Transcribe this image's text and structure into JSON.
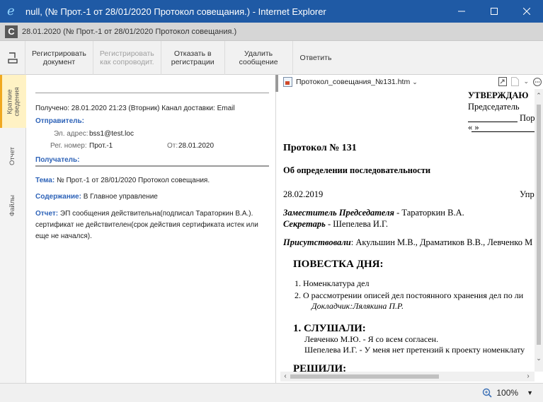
{
  "window": {
    "title": "null, (№ Прот.-1 от 28/01/2020 Протокол совещания.) - Internet Explorer",
    "ie_icon": "e"
  },
  "app": {
    "logo": "C",
    "doc_title": "28.01.2020  (№ Прот.-1 от 28/01/2020 Протокол совещания.)"
  },
  "toolbar": {
    "register_doc": "Регистрировать\nдокумент",
    "register_accomp": "Регистрировать\nкак сопроводит.",
    "refuse": "Отказать в\nрегистрации",
    "delete": "Удалить\nсообщение",
    "reply": "Ответить"
  },
  "tabs": {
    "summary": "Краткие\nсведения",
    "report": "Отчет",
    "files": "Файлы"
  },
  "info": {
    "received": "Получено: 28.01.2020 21:23 (Вторник)  Канал доставки: Email",
    "sender_label": "Отправитель:",
    "email_label": "Эл. адрес:",
    "email_value": "bss1@test.loc",
    "reg_label": "Рег. номер:",
    "reg_value": "Прот.-1",
    "from_label": "От:",
    "from_value": "28.01.2020",
    "recipient_label": "Получатель:",
    "subject_label": "Тема:",
    "subject_value": "№ Прот.-1 от 28/01/2020 Протокол совещания.",
    "content_label": "Содержание:",
    "content_value": "В Главное управление",
    "report_label": "Отчет:",
    "report_value": "ЭП сообщения действительна(подписал Тараторкин В.А.). сертификат не действителен(срок действия сертификата истек или еще не начался)."
  },
  "viewer": {
    "file_name": "Протокол_совещания_№131.htm"
  },
  "document": {
    "approve": "УТВЕРЖДАЮ",
    "chair": "Председатель",
    "chair_tail": "Пор",
    "date_line": "«       »",
    "protocol_no": "Протокол № 131",
    "subject": "Об определении последовательности",
    "date": "28.02.2019",
    "place": "Упр",
    "deputy_role": "Заместитель Председателя",
    "deputy_name": " - Тараторкин В.А.",
    "secretary_role": "Секретарь",
    "secretary_name": " - Шепелева И.Г.",
    "present_label": "Присутствовали",
    "present_names": ": Акульшин М.В., Драматиков В.В., Левченко М",
    "agenda_title": "ПОВЕСТКА ДНЯ:",
    "agenda_1": "1. Номенклатура дел",
    "agenda_2": "2. О рассмотрении описей дел постоянного хранения дел по ли",
    "speaker": "Докладчик:Лялякина П.Р.",
    "heard_title": "1. СЛУШАЛИ:",
    "heard_1": "Левченко М.Ю. - Я со всем согласен.",
    "heard_2": "Шепелева И.Г. - У меня нет претензий к проекту номенклату",
    "decided_title": "РЕШИЛИ:"
  },
  "status": {
    "zoom": "100%"
  }
}
